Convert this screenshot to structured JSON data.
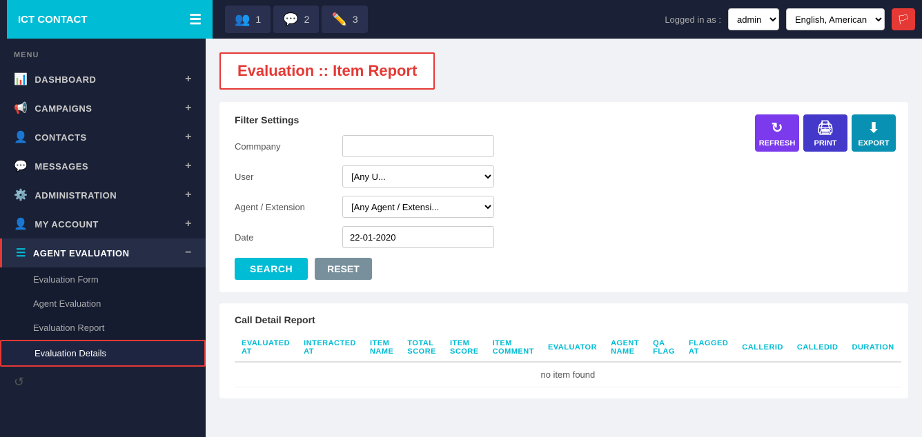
{
  "brand": {
    "name": "ICT CONTACT"
  },
  "topnav": {
    "hamburger_icon": "☰",
    "tabs": [
      {
        "icon": "👥",
        "num": "1"
      },
      {
        "icon": "💬",
        "num": "2"
      },
      {
        "icon": "✏️",
        "num": "3"
      }
    ],
    "logged_in_label": "Logged in as :",
    "user": "admin",
    "language": "English, American",
    "flag_icon": "🏳"
  },
  "sidebar": {
    "menu_label": "MENU",
    "items": [
      {
        "id": "dashboard",
        "icon": "📊",
        "label": "DASHBOARD",
        "plus": "+"
      },
      {
        "id": "campaigns",
        "icon": "📢",
        "label": "CAMPAIGNS",
        "plus": "+"
      },
      {
        "id": "contacts",
        "icon": "👤",
        "label": "CONTACTS",
        "plus": "+"
      },
      {
        "id": "messages",
        "icon": "💬",
        "label": "MESSAGES",
        "plus": "+"
      },
      {
        "id": "administration",
        "icon": "⚙️",
        "label": "ADMINISTRATION",
        "plus": "+"
      },
      {
        "id": "my-account",
        "icon": "👤",
        "label": "MY ACCOUNT",
        "plus": "+"
      },
      {
        "id": "agent-evaluation",
        "icon": "☰",
        "label": "AGENT EVALUATION",
        "minus": "−"
      }
    ],
    "sub_items": [
      {
        "id": "evaluation-form",
        "label": "Evaluation Form"
      },
      {
        "id": "agent-evaluation-sub",
        "label": "Agent Evaluation"
      },
      {
        "id": "evaluation-report",
        "label": "Evaluation Report"
      },
      {
        "id": "evaluation-details",
        "label": "Evaluation Details"
      }
    ],
    "bottom_icon": "↺"
  },
  "page": {
    "title": "Evaluation :: Item Report"
  },
  "filter": {
    "section_title": "Filter Settings",
    "fields": [
      {
        "id": "company",
        "label": "Commpany",
        "type": "text",
        "value": "",
        "placeholder": ""
      },
      {
        "id": "user",
        "label": "User",
        "type": "select",
        "value": "[Any U..."
      },
      {
        "id": "agent",
        "label": "Agent / Extension",
        "type": "select",
        "value": "[Any Agent / Extensi..."
      },
      {
        "id": "date",
        "label": "Date",
        "type": "text",
        "value": "22-01-2020"
      }
    ],
    "search_btn": "SEARCH",
    "reset_btn": "RESET"
  },
  "action_buttons": [
    {
      "id": "refresh",
      "icon": "↻",
      "label": "REFRESH",
      "class": "refresh"
    },
    {
      "id": "print",
      "icon": "🖨",
      "label": "PRINT",
      "class": "print"
    },
    {
      "id": "export",
      "icon": "⬇",
      "label": "EXPORT",
      "class": "export"
    }
  ],
  "report": {
    "title": "Call Detail Report",
    "columns": [
      "EVALUATED AT",
      "INTERACTED AT",
      "ITEM NAME",
      "TOTAL SCORE",
      "ITEM SCORE",
      "ITEM COMMENT",
      "EVALUATOR",
      "AGENT NAME",
      "QA FLAG",
      "FLAGGED AT",
      "CALLERID",
      "CALLEDID",
      "DURATION"
    ],
    "no_item_text": "no item found"
  }
}
